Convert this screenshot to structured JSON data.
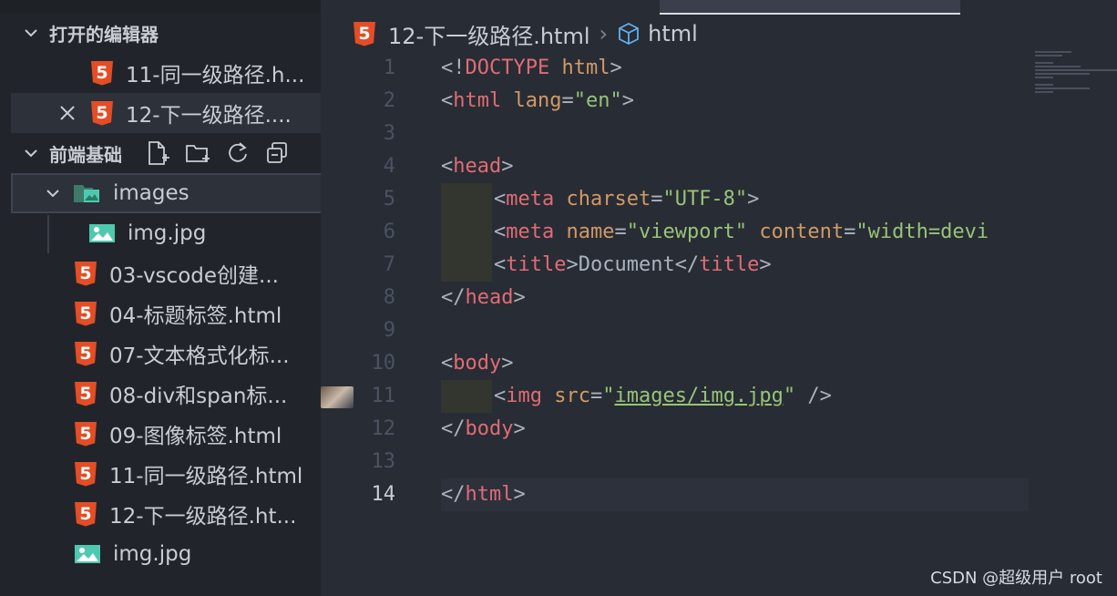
{
  "sidebar": {
    "open_editors": {
      "title": "打开的编辑器",
      "items": [
        {
          "label": "11-同一级路径.h..."
        },
        {
          "label": "12-下一级路径...."
        }
      ]
    },
    "project": {
      "title": "前端基础",
      "toolbar": [
        "new-file-icon",
        "new-folder-icon",
        "refresh-icon",
        "collapse-all-icon"
      ],
      "folder": {
        "label": "images",
        "children": [
          {
            "label": "img.jpg"
          }
        ]
      },
      "files": [
        {
          "label": "03-vscode创建...",
          "type": "html"
        },
        {
          "label": "04-标题标签.html",
          "type": "html"
        },
        {
          "label": "07-文本格式化标...",
          "type": "html"
        },
        {
          "label": "08-div和span标...",
          "type": "html"
        },
        {
          "label": "09-图像标签.html",
          "type": "html"
        },
        {
          "label": "11-同一级路径.html",
          "type": "html"
        },
        {
          "label": "12-下一级路径.ht...",
          "type": "html"
        },
        {
          "label": "img.jpg",
          "type": "image"
        }
      ]
    }
  },
  "editor": {
    "breadcrumb": {
      "file": "12-下一级路径.html",
      "separator": "›",
      "symbol": "html"
    },
    "current_line": 14,
    "lines": [
      "1",
      "2",
      "3",
      "4",
      "5",
      "6",
      "7",
      "8",
      "9",
      "10",
      "11",
      "12",
      "13",
      "14"
    ],
    "code": {
      "l1": {
        "open": "<!",
        "tag": "DOCTYPE",
        "attr": " html",
        "close": ">"
      },
      "l2": {
        "open": "<",
        "tag": "html",
        "attr": " lang",
        "eq": "=",
        "val": "\"en\"",
        "close": ">"
      },
      "l4": {
        "open": "<",
        "tag": "head",
        "close": ">"
      },
      "l5": {
        "open": "<",
        "tag": "meta",
        "attr": " charset",
        "eq": "=",
        "val": "\"UTF-8\"",
        "close": ">"
      },
      "l6": {
        "open": "<",
        "tag": "meta",
        "attr1": " name",
        "eq1": "=",
        "val1": "\"viewport\"",
        "attr2": " content",
        "eq2": "=",
        "val2": "\"width=devi"
      },
      "l7": {
        "open": "<",
        "tag": "title",
        "mid": ">Document</",
        "tag2": "title",
        "close": ">"
      },
      "l8": {
        "open": "</",
        "tag": "head",
        "close": ">"
      },
      "l10": {
        "open": "<",
        "tag": "body",
        "close": ">"
      },
      "l11": {
        "open": "<",
        "tag": "img",
        "attr": " src",
        "eq": "=",
        "q1": "\"",
        "val": "images/img.jpg",
        "q2": "\"",
        "close": " />"
      },
      "l12": {
        "open": "</",
        "tag": "body",
        "close": ">"
      },
      "l14": {
        "open": "</",
        "tag": "html",
        "close": ">"
      }
    }
  },
  "watermark": "CSDN @超级用户 root",
  "colors": {
    "tag": "#e06c75",
    "attr": "#d19a66",
    "string": "#98c379",
    "html5": "#e44d26",
    "image": "#4ec9b0"
  }
}
